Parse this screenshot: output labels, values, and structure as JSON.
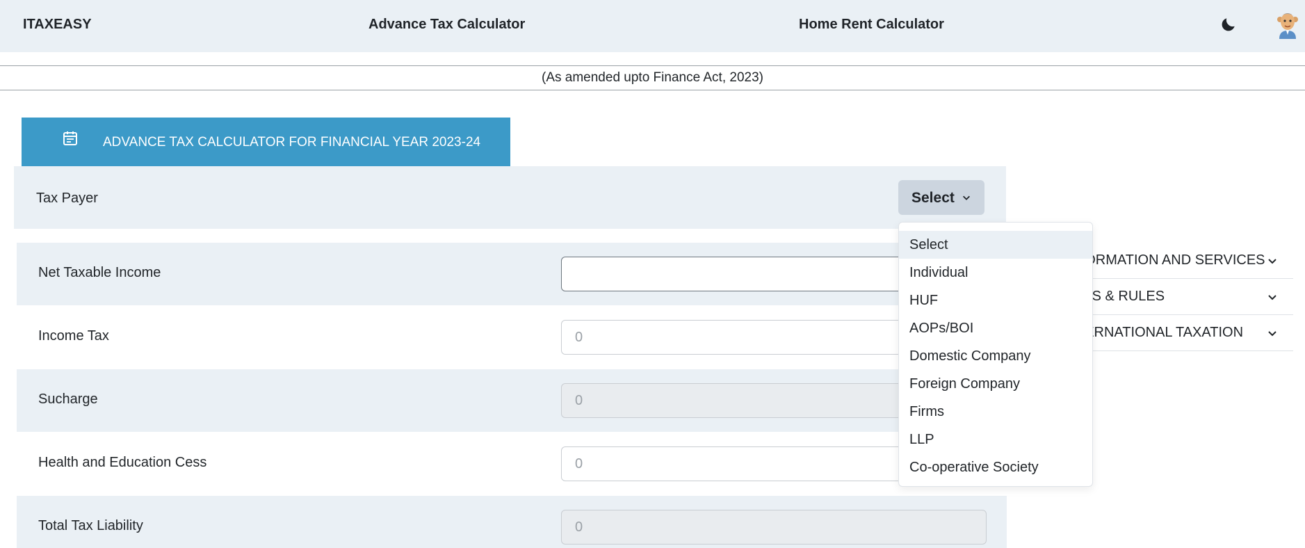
{
  "navbar": {
    "brand": "ITAXEASY",
    "links": [
      "Advance Tax Calculator",
      "Home Rent Calculator"
    ],
    "theme_icon": "moon-icon",
    "avatar_icon": "user-avatar"
  },
  "banner": {
    "text": "(As amended upto Finance Act, 2023)"
  },
  "calculator": {
    "icon": "calendar-icon",
    "title": "ADVANCE TAX CALCULATOR FOR FINANCIAL YEAR 2023-24",
    "tax_payer": {
      "label": "Tax Payer",
      "selected": "Select"
    },
    "fields": [
      {
        "label": "Net Taxable Income",
        "value": ""
      },
      {
        "label": "Income Tax",
        "value": "0"
      },
      {
        "label": "Sucharge",
        "value": "0"
      },
      {
        "label": "Health and Education Cess",
        "value": "0"
      },
      {
        "label": "Total Tax Liability",
        "value": "0"
      }
    ]
  },
  "dropdown": {
    "options": [
      "Select",
      "Individual",
      "HUF",
      "AOPs/BOI",
      "Domestic Company",
      "Foreign Company",
      "Firms",
      "LLP",
      "Co-operative Society"
    ],
    "highlighted": "Select"
  },
  "sidebar": {
    "items": [
      {
        "label": "INFORMATION AND SERVICES"
      },
      {
        "label": "LAWS & RULES"
      },
      {
        "label": "INTERNATIONAL TAXATION"
      }
    ]
  }
}
